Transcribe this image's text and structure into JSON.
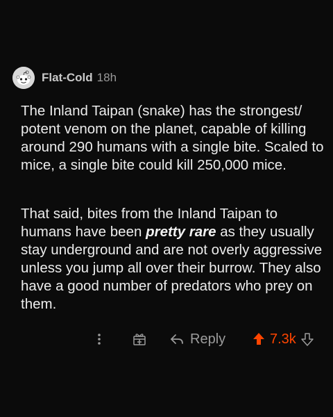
{
  "comment": {
    "author": "Flat-Cold",
    "age": "18h",
    "paragraph1": "The Inland Taipan (snake) has the strongest/ potent venom on the planet, capable of killing around 290 humans with a single bite. Scaled to mice, a single bite could kill 250,000 mice.",
    "paragraph2_before": "That said, bites from the Inland Taipan to humans have been ",
    "paragraph2_emphasis": "pretty rare",
    "paragraph2_after": " as they usually stay underground and are not overly aggressive unless you jump all over their burrow. They also have a good number of predators who prey on them."
  },
  "actions": {
    "more_icon": "more-vertical-icon",
    "award_icon": "award-gift-icon",
    "reply_icon": "reply-arrow-icon",
    "reply_label": "Reply",
    "upvote_icon": "upvote-arrow-icon",
    "vote_count": "7.3k",
    "downvote_icon": "downvote-arrow-icon"
  },
  "colors": {
    "background": "#0b0b0b",
    "upvote_accent": "#ff4500",
    "muted": "#9c9c9c"
  }
}
